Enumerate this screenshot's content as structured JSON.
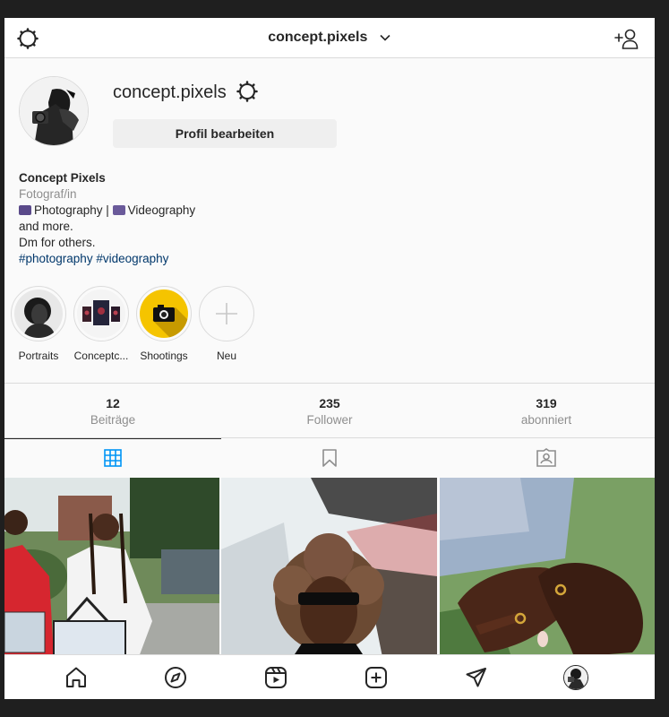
{
  "header": {
    "title": "concept.pixels"
  },
  "profile": {
    "username": "concept.pixels",
    "edit_button": "Profil bearbeiten",
    "display_name": "Concept Pixels",
    "category": "Fotograf/in",
    "bio_line1_a": "Photography | ",
    "bio_line1_b": "Videography",
    "bio_line2": "and more.",
    "bio_line3": "Dm for others.",
    "hashtags": "#photography #videography"
  },
  "highlights": [
    {
      "label": "Portraits"
    },
    {
      "label": "Conceptc..."
    },
    {
      "label": "Shootings"
    },
    {
      "label": "Neu"
    }
  ],
  "stats": [
    {
      "value": "12",
      "label": "Beiträge"
    },
    {
      "value": "235",
      "label": "Follower"
    },
    {
      "value": "319",
      "label": "abonniert"
    }
  ],
  "tabs": [
    {
      "icon": "grid-icon",
      "active": true
    },
    {
      "icon": "bookmark-icon",
      "active": false
    },
    {
      "icon": "tagged-icon",
      "active": false
    }
  ],
  "nav": [
    "home-icon",
    "explore-icon",
    "reels-icon",
    "new-post-icon",
    "direct-icon",
    "profile-avatar"
  ],
  "colors": {
    "accent": "#0095f6",
    "hashtag": "#00376b",
    "secondary_text": "#8e8e8e",
    "border": "#dbdbdb",
    "shootings_highlight": "#f5c400"
  }
}
